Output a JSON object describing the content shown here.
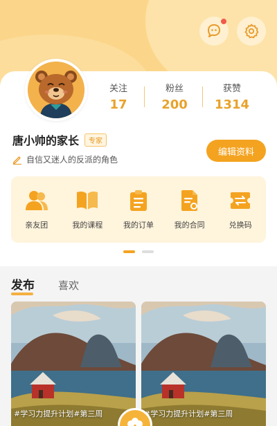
{
  "profile": {
    "name": "唐小帅的家长",
    "role_tag": "专家",
    "bio": "自信又迷人的反派的角色",
    "edit_label": "编辑资料"
  },
  "stats": [
    {
      "label": "关注",
      "value": "17"
    },
    {
      "label": "粉丝",
      "value": "200"
    },
    {
      "label": "获赞",
      "value": "1314"
    }
  ],
  "menu": [
    {
      "label": "亲友团",
      "icon": "people-icon"
    },
    {
      "label": "我的课程",
      "icon": "book-icon"
    },
    {
      "label": "我的订单",
      "icon": "clipboard-icon"
    },
    {
      "label": "我的合同",
      "icon": "contract-icon"
    },
    {
      "label": "兑换码",
      "icon": "exchange-icon"
    }
  ],
  "tabs": [
    {
      "label": "发布",
      "active": true
    },
    {
      "label": "喜欢",
      "active": false
    }
  ],
  "posts": [
    {
      "caption": "#学习力提升计划#第三周"
    },
    {
      "caption": "#学习力提升计划#第三周"
    }
  ],
  "colors": {
    "accent": "#f4a320",
    "header": "#fbd68a",
    "stat_number": "#e8a22b"
  }
}
